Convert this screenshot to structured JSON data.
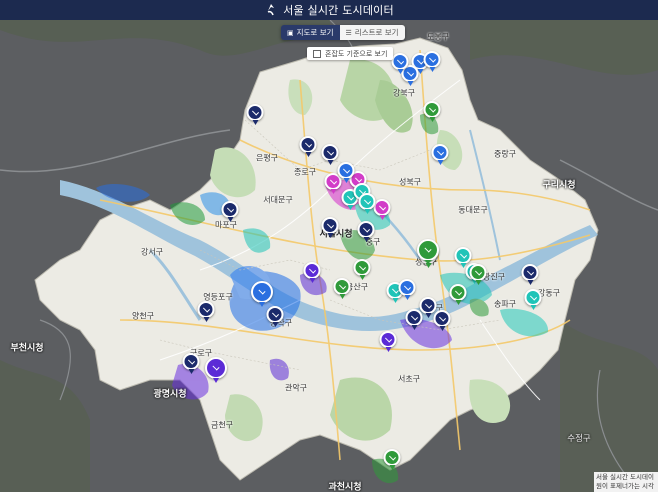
{
  "header": {
    "title": "서울 실시간 도시데이터"
  },
  "view_toggle": {
    "map_label": "지도로 보기",
    "list_label": "리스트로 보기"
  },
  "congestion_filter": {
    "label": "혼잡도 기준으로 보기"
  },
  "footer": {
    "line1": "서울 실시간 도시데이",
    "line2": "원이 표제너가는 시각"
  },
  "colors": {
    "header": "#1c2a4f",
    "blue": "#2a6fe0",
    "purple": "#5b2bd6",
    "teal": "#20c4b8",
    "green": "#2f9a3a",
    "magenta": "#d23cc8",
    "navy": "#1b2a6b"
  },
  "districts": [
    {
      "name": "도봉구"
    },
    {
      "name": "강북구"
    },
    {
      "name": "은평구"
    },
    {
      "name": "종로구"
    },
    {
      "name": "성북구"
    },
    {
      "name": "동대문구"
    },
    {
      "name": "서대문구"
    },
    {
      "name": "마포구"
    },
    {
      "name": "중구"
    },
    {
      "name": "서울시청"
    },
    {
      "name": "성동구"
    },
    {
      "name": "광진구"
    },
    {
      "name": "강서구"
    },
    {
      "name": "양천구"
    },
    {
      "name": "영등포구"
    },
    {
      "name": "동작구"
    },
    {
      "name": "용산구"
    },
    {
      "name": "강남구"
    },
    {
      "name": "송파구"
    },
    {
      "name": "강동구"
    },
    {
      "name": "구로구"
    },
    {
      "name": "금천구"
    },
    {
      "name": "관악구"
    },
    {
      "name": "서초구"
    },
    {
      "name": "중랑구"
    }
  ],
  "outside_labels": [
    {
      "name": "구리시청"
    },
    {
      "name": "부천시청"
    },
    {
      "name": "광명시청"
    },
    {
      "name": "과천시청"
    },
    {
      "name": "수정구"
    }
  ],
  "markers": [
    {
      "color": "blue",
      "big": false
    },
    {
      "color": "blue",
      "big": false
    },
    {
      "color": "blue",
      "big": false
    },
    {
      "color": "blue",
      "big": false
    },
    {
      "color": "green",
      "big": false
    },
    {
      "color": "navy",
      "big": false
    },
    {
      "color": "navy",
      "big": false
    },
    {
      "color": "navy",
      "big": false
    },
    {
      "color": "navy",
      "big": false
    },
    {
      "color": "magenta",
      "big": false
    },
    {
      "color": "magenta",
      "big": false
    },
    {
      "color": "magenta",
      "big": false
    },
    {
      "color": "teal",
      "big": false
    },
    {
      "color": "teal",
      "big": false
    },
    {
      "color": "teal",
      "big": false
    },
    {
      "color": "blue",
      "big": false
    },
    {
      "color": "blue",
      "big": false
    },
    {
      "color": "green",
      "big": false
    },
    {
      "color": "green",
      "big": false
    },
    {
      "color": "green",
      "big": false
    },
    {
      "color": "green",
      "big": true
    },
    {
      "color": "teal",
      "big": false
    },
    {
      "color": "teal",
      "big": false
    },
    {
      "color": "purple",
      "big": false
    },
    {
      "color": "blue",
      "big": true
    },
    {
      "color": "navy",
      "big": false
    },
    {
      "color": "navy",
      "big": false
    },
    {
      "color": "navy",
      "big": false
    },
    {
      "color": "purple",
      "big": true
    },
    {
      "color": "navy",
      "big": false
    },
    {
      "color": "teal",
      "big": false
    },
    {
      "color": "green",
      "big": false
    },
    {
      "color": "green",
      "big": false
    },
    {
      "color": "navy",
      "big": false
    },
    {
      "color": "navy",
      "big": false
    },
    {
      "color": "purple",
      "big": false
    },
    {
      "color": "navy",
      "big": false
    },
    {
      "color": "navy",
      "big": false
    },
    {
      "color": "teal",
      "big": false
    },
    {
      "color": "green",
      "big": false
    },
    {
      "color": "navy",
      "big": false
    },
    {
      "color": "blue",
      "big": false
    },
    {
      "color": "green",
      "big": false
    }
  ]
}
